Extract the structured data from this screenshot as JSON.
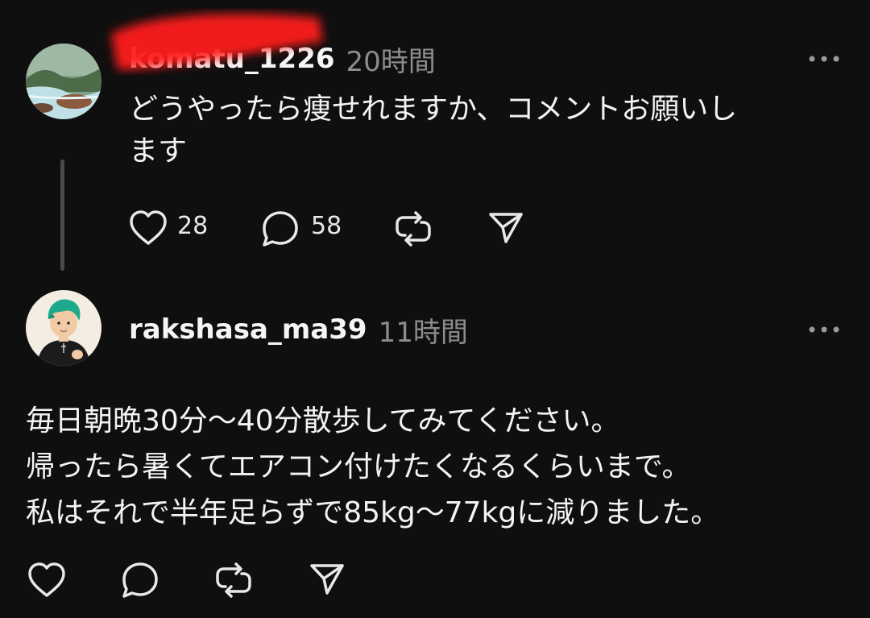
{
  "posts": [
    {
      "username": "komatu_1226",
      "time": "20時間",
      "text_lines": [
        "どうやったら痩せれますか、コメントお願いし",
        "ます"
      ],
      "actions": {
        "likes": "28",
        "replies": "58"
      }
    },
    {
      "username": "rakshasa_ma39",
      "time": "11時間",
      "text_lines": [
        "毎日朝晩30分〜40分散歩してみてください。",
        "帰ったら暑くてエアコン付けたくなるくらいまで。",
        "私はそれで半年足らずで85kg〜77kgに減りました。"
      ]
    }
  ],
  "colors": {
    "background": "#0f0f0f",
    "redaction": "#ff1a1a",
    "muted": "#8c8c8c"
  },
  "icons": [
    "heart-icon",
    "comment-icon",
    "repost-icon",
    "share-icon",
    "more-icon"
  ]
}
